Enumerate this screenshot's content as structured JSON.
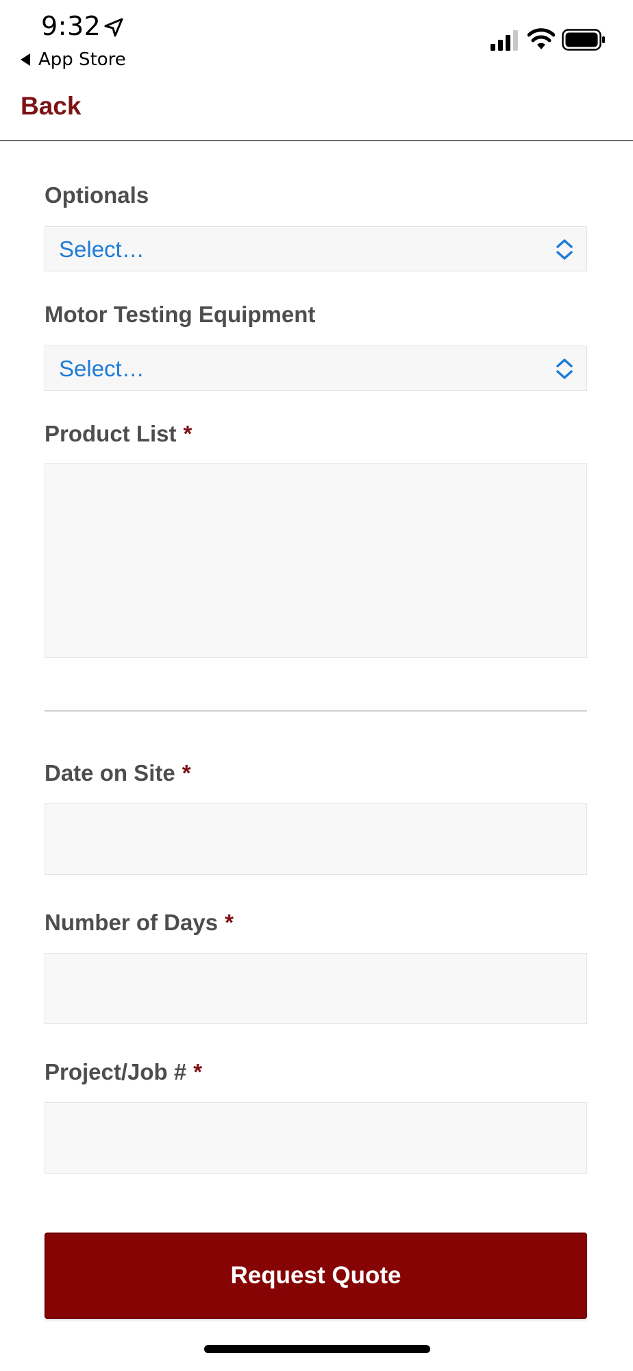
{
  "status_bar": {
    "time": "9:32",
    "back_app_label": "App Store",
    "icons": [
      "location-arrow-icon",
      "cellular-signal-icon",
      "wifi-icon",
      "battery-icon"
    ]
  },
  "nav": {
    "back_label": "Back"
  },
  "form": {
    "optionals": {
      "label": "Optionals",
      "value": "Select…"
    },
    "motor_testing": {
      "label": "Motor Testing Equipment",
      "value": "Select…"
    },
    "product_list": {
      "label": "Product List",
      "required_mark": "*",
      "value": ""
    },
    "date_on_site": {
      "label": "Date on Site",
      "required_mark": "*",
      "value": ""
    },
    "number_of_days": {
      "label": "Number of Days",
      "required_mark": "*",
      "value": ""
    },
    "project_job": {
      "label": "Project/Job #",
      "required_mark": "*",
      "value": ""
    },
    "submit_label": "Request Quote"
  },
  "colors": {
    "brand": "#7d1315",
    "button": "#870404",
    "select_text": "#1e7bd6",
    "field_bg": "#f8f8f8",
    "label": "#4d4d4d"
  }
}
